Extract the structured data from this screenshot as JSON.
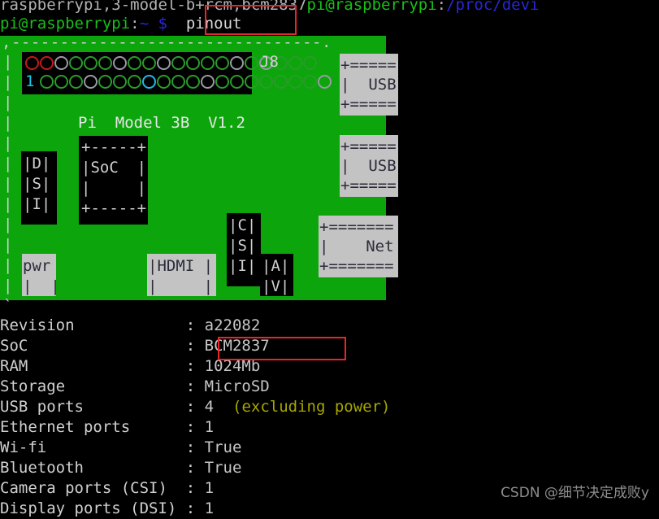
{
  "terminal": {
    "scrollback_line": {
      "text_grey": "raspberrypi,3-model-b+rcm,bcm2837",
      "text_green": "pi@raspberrypi",
      "text_sep": ":",
      "text_blue": "/proc/devi"
    },
    "prompt": {
      "user_host": "pi@raspberrypi",
      "colon": ":",
      "path": "~",
      "dollar": "$",
      "command": "pinout"
    }
  },
  "board": {
    "top_border": ",--------------------------------.",
    "left_border": "|",
    "bottom_left": "`",
    "header_label": "J8",
    "model_label": "Pi  Model 3B  V1.2",
    "soc": {
      "top": "+-----+",
      "mid": "|SoC  |",
      "low": "|     |",
      "bot": "+-----+"
    },
    "dsi": [
      "|D|",
      "|S|",
      "|I|"
    ],
    "csi": [
      "|C|",
      "|S|",
      "|I|"
    ],
    "av": [
      "|A|",
      "|V|"
    ],
    "pwr": [
      "pwr",
      "|  |"
    ],
    "hdmi": [
      "|HDMI |",
      "|     |"
    ],
    "usb1": [
      "+=====",
      "|  USB",
      "+====="
    ],
    "usb2": [
      "+=====",
      "|  USB",
      "+====="
    ],
    "net": [
      "+=======",
      "|    Net",
      "+======="
    ],
    "pin_one_label": "1",
    "pins_top_row": [
      "pwr-red",
      "pwr-red",
      "gnd",
      "gpio",
      "gpio",
      "gpio",
      "gnd",
      "gpio",
      "gpio",
      "gnd",
      "gpio",
      "gpio",
      "gpio",
      "gpio",
      "gnd",
      "gpio",
      "gnd",
      "gpio",
      "gpio",
      "gpio"
    ],
    "pins_bottom_row": [
      "gpio",
      "gpio",
      "gpio",
      "gnd",
      "gpio",
      "gpio",
      "gpio",
      "special",
      "gpio",
      "gpio",
      "gpio",
      "gnd",
      "gpio",
      "gpio",
      "gpio",
      "gpio",
      "gpio",
      "gpio",
      "gpio",
      "gnd"
    ]
  },
  "info": {
    "rows": [
      {
        "key": "Revision",
        "sep": ":",
        "value": "a22082",
        "note": ""
      },
      {
        "key": "SoC",
        "sep": ":",
        "value": "BCM2837",
        "note": ""
      },
      {
        "key": "RAM",
        "sep": ":",
        "value": "1024Mb",
        "note": ""
      },
      {
        "key": "Storage",
        "sep": ":",
        "value": "MicroSD",
        "note": ""
      },
      {
        "key": "USB ports",
        "sep": ":",
        "value": "4",
        "note": "(excluding power)"
      },
      {
        "key": "Ethernet ports",
        "sep": ":",
        "value": "1",
        "note": ""
      },
      {
        "key": "Wi-fi",
        "sep": ":",
        "value": "True",
        "note": ""
      },
      {
        "key": "Bluetooth",
        "sep": ":",
        "value": "True",
        "note": ""
      },
      {
        "key": "Camera ports (CSI)",
        "sep": ":",
        "value": "1",
        "note": ""
      },
      {
        "key": "Display ports (DSI)",
        "sep": ":",
        "value": "1",
        "note": ""
      }
    ]
  },
  "annotations": {
    "highlight_command": "pinout",
    "highlight_soc": "BCM2837",
    "box_color": "#e8262a"
  },
  "watermark": {
    "text": "CSDN @细节决定成败y"
  }
}
